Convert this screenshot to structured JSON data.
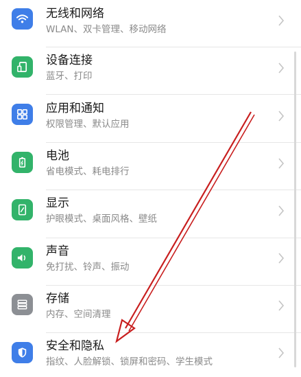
{
  "settings": {
    "items": [
      {
        "title": "无线和网络",
        "subtitle": "WLAN、双卡管理、移动网络",
        "icon": "wifi-icon",
        "color": "#3f7ee8"
      },
      {
        "title": "设备连接",
        "subtitle": "蓝牙、打印",
        "icon": "device-connect-icon",
        "color": "#32b36a"
      },
      {
        "title": "应用和通知",
        "subtitle": "权限管理、默认应用",
        "icon": "apps-grid-icon",
        "color": "#3f7ee8"
      },
      {
        "title": "电池",
        "subtitle": "省电模式、耗电排行",
        "icon": "battery-icon",
        "color": "#32b36a"
      },
      {
        "title": "显示",
        "subtitle": "护眼模式、桌面风格、壁纸",
        "icon": "display-icon",
        "color": "#32b36a"
      },
      {
        "title": "声音",
        "subtitle": "免打扰、铃声、振动",
        "icon": "speaker-icon",
        "color": "#32b36a"
      },
      {
        "title": "存储",
        "subtitle": "内存、空间清理",
        "icon": "storage-icon",
        "color": "#8c8f94"
      },
      {
        "title": "安全和隐私",
        "subtitle": "指纹、人脸解锁、锁屏和密码、学生模式",
        "icon": "shield-icon",
        "color": "#3f7ee8"
      }
    ]
  },
  "colors": {
    "annotation_arrow": "#c81e1e"
  }
}
